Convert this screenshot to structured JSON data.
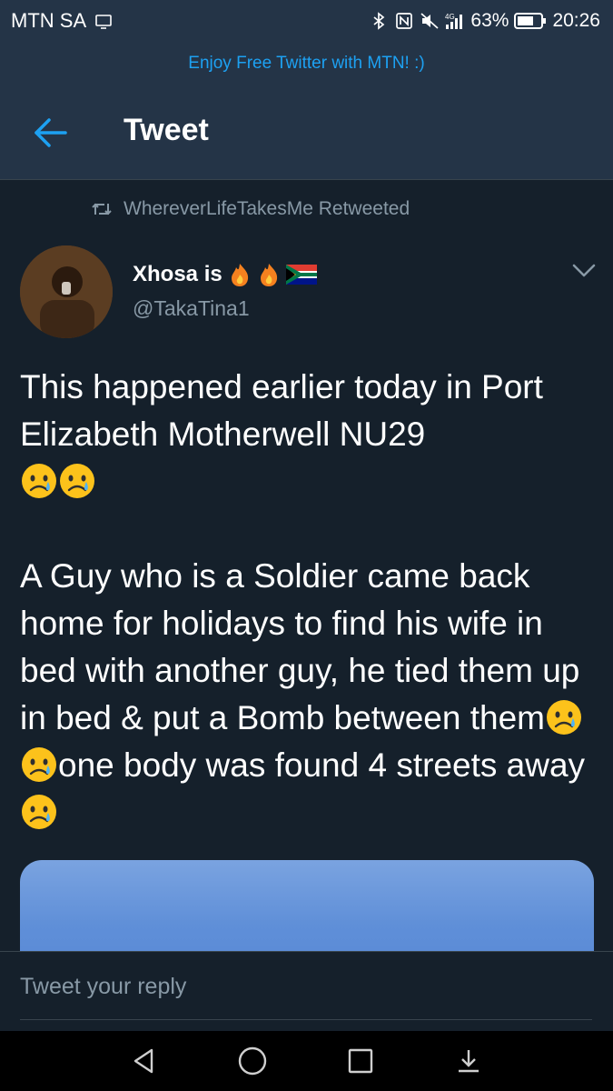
{
  "status": {
    "carrier": "MTN SA",
    "battery": "63%",
    "time": "20:26",
    "icons": [
      "screen-cast-icon",
      "bluetooth-icon",
      "nfc-icon",
      "muted-icon",
      "signal-4g-icon",
      "battery-icon"
    ]
  },
  "promo": {
    "text": "Enjoy Free Twitter with MTN! :)"
  },
  "header": {
    "title": "Tweet"
  },
  "retweet": {
    "text": "WhereverLifeTakesMe Retweeted"
  },
  "author": {
    "name": "Xhosa is",
    "handle": "@TakaTina1",
    "name_emojis": [
      "fire-emoji",
      "fire-emoji",
      "south-africa-flag-emoji"
    ]
  },
  "tweet": {
    "line1": "This happened earlier today in Port Elizabeth Motherwell NU29",
    "line2_a": "A Guy who is a Soldier came back home for holidays to find his wife in bed with another guy, he tied them up in bed & put a Bomb between them",
    "line2_b": "one body was found 4 streets away"
  },
  "reply": {
    "placeholder": "Tweet your reply"
  },
  "colors": {
    "background": "#15202b",
    "bar": "#243447",
    "accent": "#1da1f2",
    "muted": "#8899a6"
  }
}
